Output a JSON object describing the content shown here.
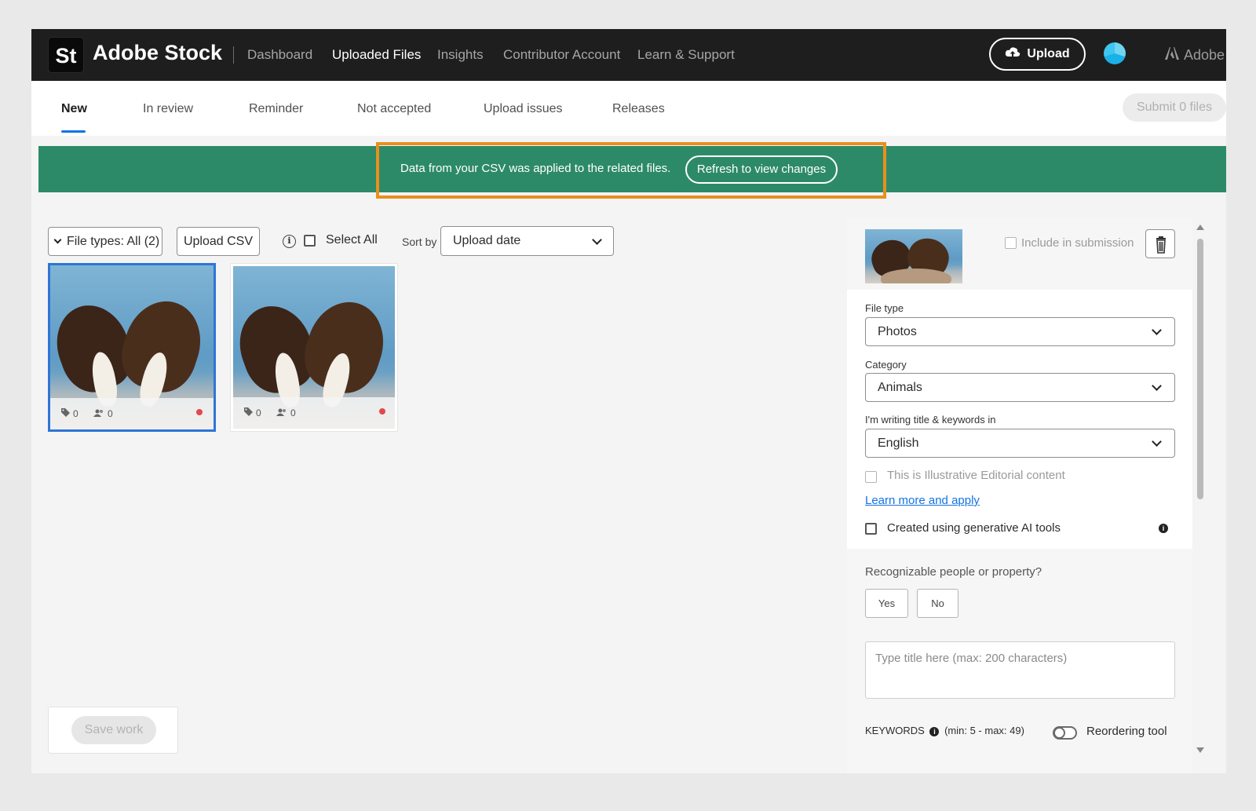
{
  "header": {
    "logo_text": "St",
    "brand": "Adobe Stock",
    "nav": [
      "Dashboard",
      "Uploaded Files",
      "Insights",
      "Contributor Account",
      "Learn & Support"
    ],
    "active_nav": "Uploaded Files",
    "upload_label": "Upload",
    "adobe_label": "Adobe"
  },
  "subnav": {
    "tabs": [
      "New",
      "In review",
      "Reminder",
      "Not accepted",
      "Upload issues",
      "Releases"
    ],
    "active_tab": "New",
    "submit_label": "Submit 0 files"
  },
  "banner": {
    "message": "Data from your CSV was applied to the related files.",
    "button": "Refresh to view changes",
    "color": "#2d8a68",
    "highlight_color": "#e8901e"
  },
  "toolbar": {
    "file_types": "File types: All (2)",
    "upload_csv": "Upload CSV",
    "select_all": "Select All",
    "sort_by": "Sort by",
    "sort_value": "Upload date"
  },
  "files": [
    {
      "keywords": "0",
      "people": "0",
      "selected": true
    },
    {
      "keywords": "0",
      "people": "0",
      "selected": false
    }
  ],
  "save_work": "Save work",
  "panel": {
    "include_label": "Include in submission",
    "file_type_label": "File type",
    "file_type_value": "Photos",
    "category_label": "Category",
    "category_value": "Animals",
    "language_label": "I'm writing title & keywords in",
    "language_value": "English",
    "editorial_label": "This is Illustrative Editorial content",
    "learn_more": "Learn more and apply",
    "gen_ai_label": "Created using generative AI tools",
    "recognizable_label": "Recognizable people or property?",
    "yes": "Yes",
    "no": "No",
    "title_placeholder": "Type title here (max: 200 characters)",
    "keywords_label": "KEYWORDS",
    "keywords_range": "(min: 5 - max: 49)",
    "reorder_label": "Reordering tool"
  }
}
